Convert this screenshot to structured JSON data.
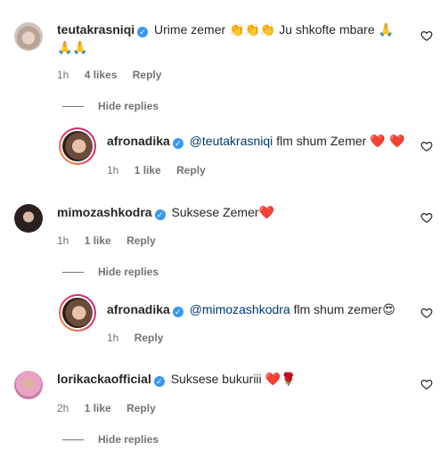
{
  "comments": [
    {
      "username": "teutakrasniqi",
      "text": "Urime zemer",
      "emoji_a": "👏👏👏",
      "text2": "Ju shkofte mbare",
      "emoji_b": "🙏",
      "emoji_line2": "🙏🙏",
      "time": "1h",
      "likes": "4 likes",
      "reply_label": "Reply",
      "hide_replies": "Hide replies"
    },
    {
      "username": "afronadika",
      "mention": "@teutakrasniqi",
      "text": "flm shum Zemer",
      "emoji": "❤️ ❤️",
      "time": "1h",
      "likes": "1 like",
      "reply_label": "Reply"
    },
    {
      "username": "mimozashkodra",
      "text": "Suksese Zemer",
      "emoji": "❤️",
      "time": "1h",
      "likes": "1 like",
      "reply_label": "Reply",
      "hide_replies": "Hide replies"
    },
    {
      "username": "afronadika",
      "mention": "@mimozashkodra",
      "text": "flm shum zemer",
      "emoji": "😍",
      "time": "1h",
      "reply_label": "Reply"
    },
    {
      "username": "lorikackaofficial",
      "text": "Suksese bukuriii",
      "emoji": "❤️🌹",
      "time": "2h",
      "likes": "1 like",
      "reply_label": "Reply",
      "hide_replies": "Hide replies"
    }
  ],
  "icons": {
    "verified": "✓",
    "like": "heart-outline-icon"
  },
  "colors": {
    "verified": "#3897f0",
    "mention": "#00376b",
    "meta": "#737373"
  }
}
